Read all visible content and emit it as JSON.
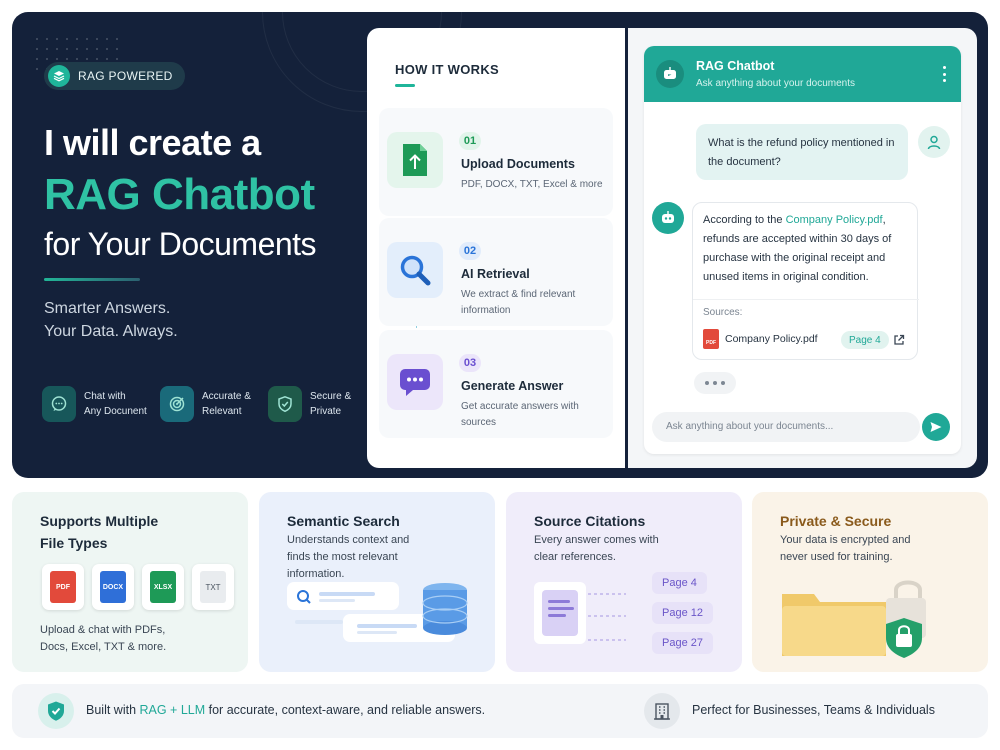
{
  "hero": {
    "badge": "RAG POWERED",
    "headline_line1": "I will create a",
    "headline_line2": "RAG Chatbot",
    "headline_line3": "for Your Documents",
    "tagline_line1": "Smarter Answers.",
    "tagline_line2": "Your Data. Always.",
    "features": [
      {
        "line1": "Chat with",
        "line2": "Any Docunent",
        "icon": "chat-bubble-icon"
      },
      {
        "line1": "Accurate &",
        "line2": "Relevant",
        "icon": "target-icon"
      },
      {
        "line1": "Secure &",
        "line2": "Private",
        "icon": "shield-check-icon"
      }
    ]
  },
  "how_it_works": {
    "title": "HOW IT WORKS",
    "steps": [
      {
        "num": "01",
        "title": "Upload Documents",
        "desc": "PDF, DOCX, TXT, Excel & more",
        "icon": "upload-document-icon"
      },
      {
        "num": "02",
        "title": "AI Retrieval",
        "desc": "We extract & find relevant information",
        "icon": "magnifier-icon"
      },
      {
        "num": "03",
        "title": "Generate Answer",
        "desc": "Get accurate answers with sources",
        "icon": "chat-answer-icon"
      }
    ]
  },
  "chat": {
    "title": "RAG Chatbot",
    "subtitle": "Ask anything about your documents",
    "user_message": "What is the refund policy mentioned in the document?",
    "bot_message_prefix": "According to the ",
    "bot_message_highlight": "Company Policy.pdf",
    "bot_message_suffix": ", refunds are accepted within 30 days of purchase with the original receipt and unused items in original condition.",
    "sources_label": "Sources:",
    "source_file": "Company Policy.pdf",
    "source_page": "Page 4",
    "input_placeholder": "Ask anything about your documents..."
  },
  "cards": {
    "file_types": {
      "title_line1": "Supports Multiple",
      "title_line2": "File Types",
      "types": [
        "PDF",
        "DOCX",
        "XLSX",
        "TXT"
      ],
      "caption_line1": "Upload & chat with PDFs,",
      "caption_line2": "Docs, Excel, TXT & more."
    },
    "semantic": {
      "title": "Semantic Search",
      "desc_line1": "Understands context and",
      "desc_line2": "finds the most relevant",
      "desc_line3": "information."
    },
    "citations": {
      "title": "Source Citations",
      "desc_line1": "Every answer comes with",
      "desc_line2": "clear references.",
      "pages": [
        "Page 4",
        "Page 12",
        "Page 27"
      ]
    },
    "secure": {
      "title": "Private & Secure",
      "desc_line1": "Your data is encrypted and",
      "desc_line2": "never used for training."
    }
  },
  "footer": {
    "left_prefix": "Built with ",
    "left_highlight": "RAG + LLM",
    "left_suffix": " for accurate, context-aware, and reliable answers.",
    "right": "Perfect for Businesses, Teams & Individuals"
  },
  "colors": {
    "navy": "#14213a",
    "teal": "#20a897",
    "teal_bright": "#2fc2a4",
    "purple": "#6a55c8",
    "gold": "#8a5a1c"
  }
}
